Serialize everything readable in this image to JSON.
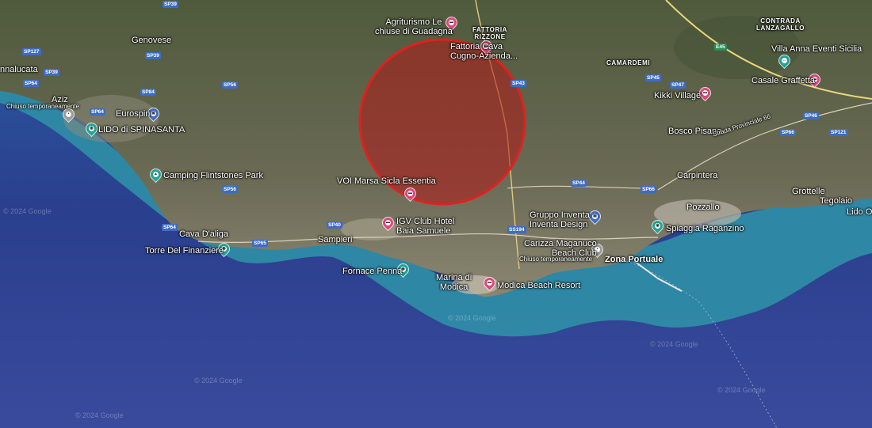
{
  "map": {
    "type": "satellite",
    "accent_circle_color": "#e02020",
    "sea_color": "#2b3f8c",
    "coast_color": "#2f95a8"
  },
  "watermark": "© 2024 Google",
  "places": {
    "agriturismo": "Agriturismo Le\nchiuse di Guadagna",
    "fattoria_rizzone": "FATTORIA\nRIZZONE",
    "fattoria_cava": "Fattoria Cava\nCugno-Azienda...",
    "contrada": "CONTRADA\nLANZAGALLO",
    "villa_anna": "Villa Anna Eventi Sicilia",
    "camardemi": "CAMARDEMI",
    "casale": "Casale Graffetta",
    "kikki": "Kikki Village",
    "genovese": "Genovese",
    "nnalucata": "nnalucata",
    "aziz": "Aziz",
    "chiuso1": "Chiuso temporaneamente",
    "eurospin": "Eurospin",
    "lido_spinasanta": "LIDO di SPINASANTA",
    "camping": "Camping Flintstones Park",
    "bosco": "Bosco Pisana",
    "strada": "Strada Provinciale 66",
    "carpintera": "Carpintera",
    "grottelle": "Grottelle",
    "tegolaio": "Tegolaio",
    "lido_ot": "Lido Ot",
    "voi": "VOI Marsa Sicla Essentia",
    "igv": "IGV Club Hotel\nBaia Samuele",
    "gruppo": "Gruppo Inventa\nInventa Design",
    "pozzallo": "Pozzallo",
    "spiaggia": "Spiaggia Raganzino",
    "cava": "Cava D'aliga",
    "sampieri": "Sampieri",
    "torre": "Torre Del Finanziere",
    "carizza": "Carizza Maganuco\nBeach Club",
    "chiuso2": "Chiuso temporaneamente",
    "zona": "Zona Portuale",
    "fornace": "Fornace Penna",
    "marina": "Marina di\nModica",
    "modica_beach": "Modica Beach Resort"
  },
  "roads": {
    "sp39a": "SP39",
    "sp127": "SP127",
    "sp39b": "SP39",
    "sp39c": "SP39",
    "sp64a": "SP64",
    "sp84": "SP84",
    "sp56a": "SP56",
    "sp64b": "SP64",
    "sp43": "SP43",
    "sp45": "SP45",
    "sp47": "SP47",
    "e45": "E45",
    "sp66a": "SP66",
    "sp46": "SP46",
    "sp121": "SP121",
    "sp56b": "SP56",
    "sp44": "SP44",
    "sp66b": "SP66",
    "sp40": "SP40",
    "sp64c": "SP64",
    "sp65": "SP65",
    "ss194": "SS194"
  }
}
